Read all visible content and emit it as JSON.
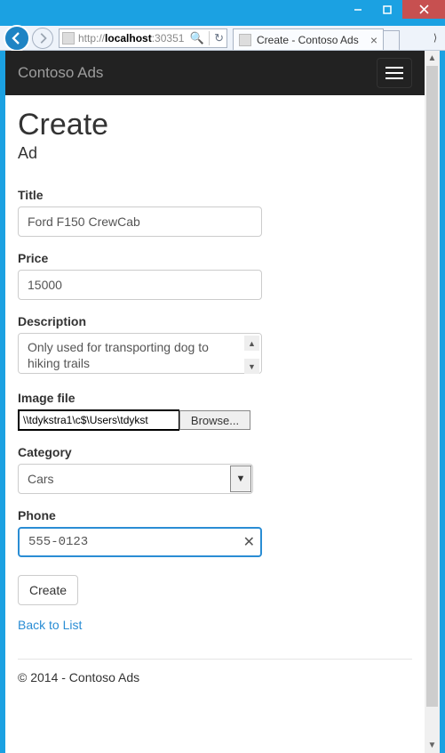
{
  "window": {
    "url_host": "localhost",
    "url_prefix": "http://",
    "url_suffix": ":30351",
    "tab_title": "Create - Contoso Ads"
  },
  "app": {
    "brand": "Contoso Ads"
  },
  "page": {
    "title": "Create",
    "subtitle": "Ad"
  },
  "form": {
    "title_label": "Title",
    "title_value": "Ford F150 CrewCab",
    "price_label": "Price",
    "price_value": "15000",
    "description_label": "Description",
    "description_value": "Only used for transporting dog to hiking trails",
    "imagefile_label": "Image file",
    "imagefile_value": "\\\\tdykstra1\\c$\\Users\\tdykst",
    "imagefile_browse": "Browse...",
    "category_label": "Category",
    "category_value": "Cars",
    "phone_label": "Phone",
    "phone_value": "555-0123",
    "submit_label": "Create",
    "back_link": "Back to List"
  },
  "footer": {
    "text": "© 2014 - Contoso Ads"
  }
}
